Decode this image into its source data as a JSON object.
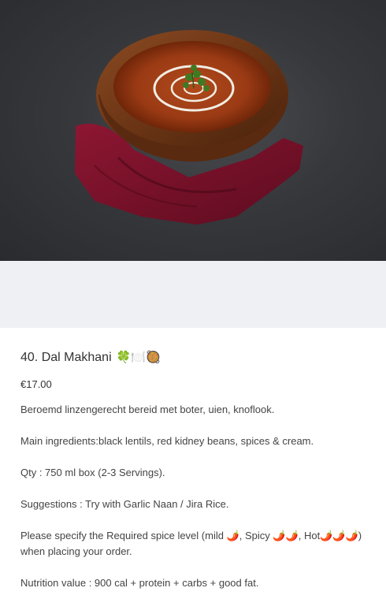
{
  "product": {
    "image_alt": "Dal Makhani in wooden bowl",
    "title": "40. Dal Makhani",
    "title_emojis": "🍀🍽️🥘",
    "price": "€17.00",
    "description": [
      "Beroemd linzengerecht bereid met boter, uien, knoflook.",
      "Main ingredients:black lentils, red kidney beans, spices & cream.",
      "Qty : 750 ml box (2-3 Servings).",
      "Suggestions : Try with Garlic Naan / Jira Rice.",
      "Please specify the Required spice level (mild 🌶️, Spicy 🌶️🌶️, Hot🌶️🌶️🌶️) when placing your order.",
      "Nutrition value : 900 cal + protein + carbs + good fat."
    ]
  },
  "colors": {
    "background_dark": "#333538",
    "gap": "#eff0f3",
    "text": "#333333"
  }
}
